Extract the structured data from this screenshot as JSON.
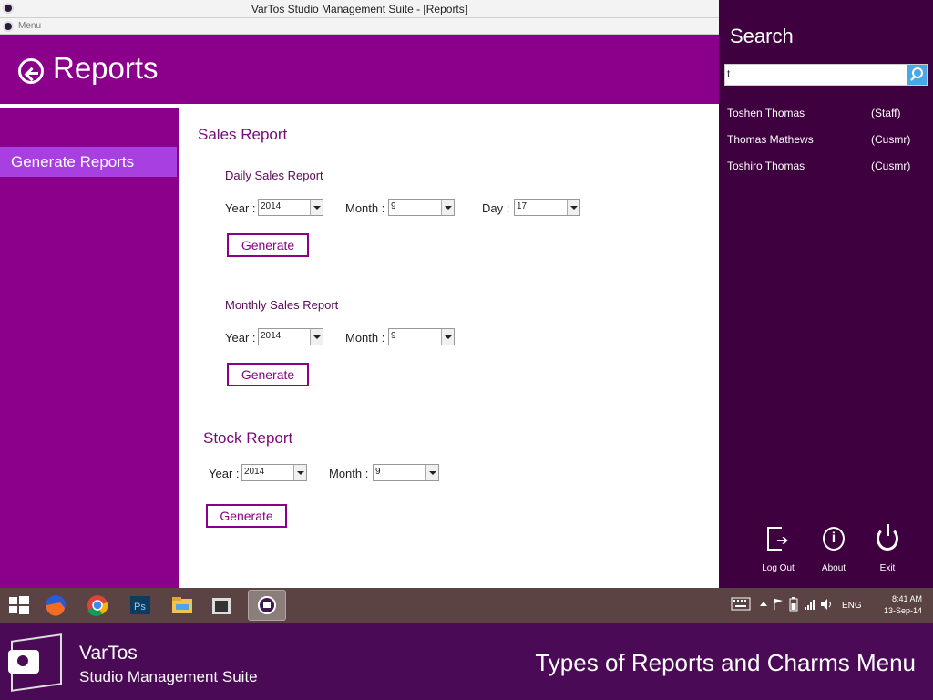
{
  "window": {
    "title": "VarTos Studio Management Suite  - [Reports]",
    "menu": "Menu"
  },
  "header": {
    "title": "Reports"
  },
  "sidebar": {
    "items": [
      {
        "label": "Generate Reports"
      }
    ]
  },
  "sales": {
    "title": "Sales Report",
    "daily": {
      "title": "Daily Sales Report",
      "year_label": "Year :",
      "year": "2014",
      "month_label": "Month :",
      "month": "9",
      "day_label": "Day :",
      "day": "17",
      "button": "Generate"
    },
    "monthly": {
      "title": "Monthly Sales Report",
      "year_label": "Year :",
      "year": "2014",
      "month_label": "Month :",
      "month": "9",
      "button": "Generate"
    }
  },
  "stock": {
    "title": "Stock Report",
    "year_label": "Year :",
    "year": "2014",
    "month_label": "Month :",
    "month": "9",
    "button": "Generate"
  },
  "charms": {
    "title": "Search",
    "search_value": "t",
    "results": [
      {
        "name": "Toshen Thomas",
        "type": "(Staff)"
      },
      {
        "name": "Thomas Mathews",
        "type": "(Cusmr)"
      },
      {
        "name": "Toshiro Thomas",
        "type": "(Cusmr)"
      }
    ],
    "buttons": {
      "logout": "Log  Out",
      "about": "About",
      "exit": "Exit"
    }
  },
  "taskbar": {
    "language": "ENG",
    "time": "8:41 AM",
    "date": "13-Sep-14"
  },
  "footer": {
    "brand_name": "VarTos",
    "brand_subtitle": "Studio Management Suite",
    "tagline": "Types of Reports and Charms Menu"
  },
  "colors": {
    "accent": "#8b008b",
    "charms_bg": "#3f003f",
    "sidebar_selected": "#a83fe0",
    "taskbar": "#5a4342"
  }
}
